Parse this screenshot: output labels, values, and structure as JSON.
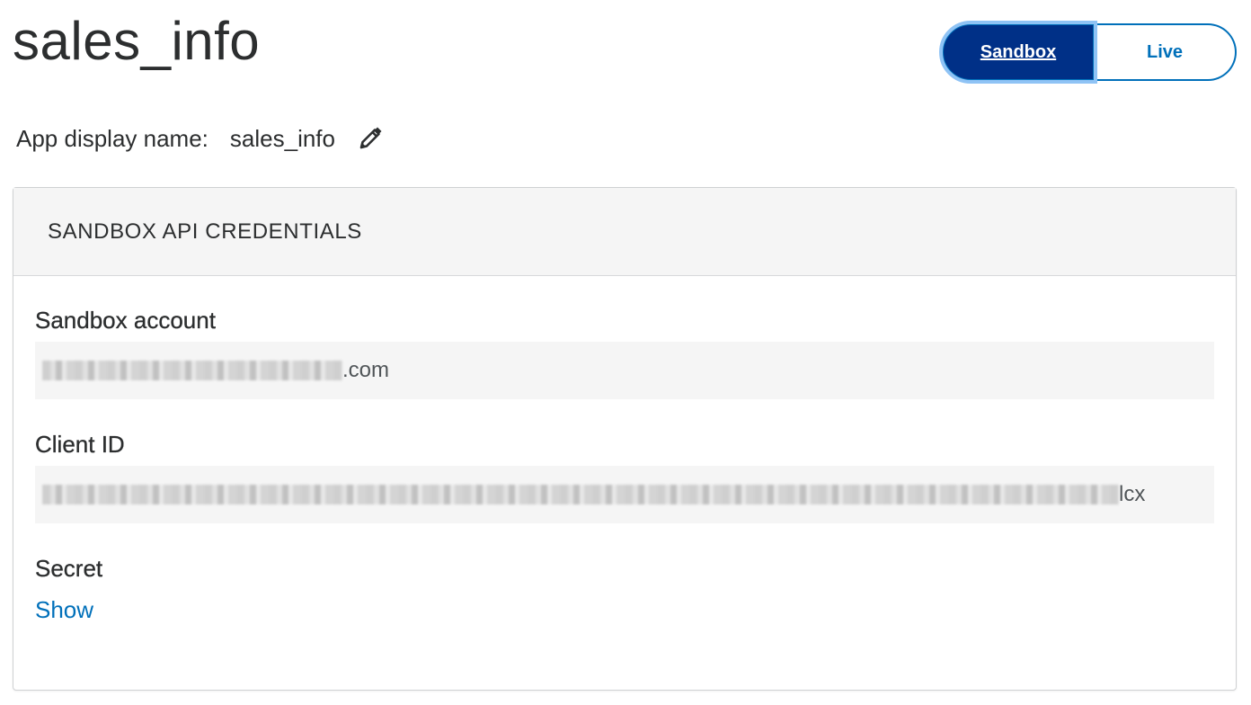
{
  "app": {
    "title": "sales_info"
  },
  "env_toggle": {
    "sandbox_label": "Sandbox",
    "live_label": "Live",
    "selected": "Sandbox"
  },
  "display_name": {
    "label": "App display name:",
    "value": "sales_info",
    "edit_icon": "pencil-icon"
  },
  "credentials": {
    "header": "SANDBOX API CREDENTIALS",
    "sandbox_account": {
      "label": "Sandbox account",
      "value_suffix": ".com"
    },
    "client_id": {
      "label": "Client ID",
      "value_suffix": "lcx"
    },
    "secret": {
      "label": "Secret",
      "show_label": "Show"
    }
  },
  "colors": {
    "primary_dark": "#003087",
    "link_blue": "#0070ba",
    "focus_ring": "#8fc3f5",
    "panel_bg": "#f5f5f5"
  }
}
